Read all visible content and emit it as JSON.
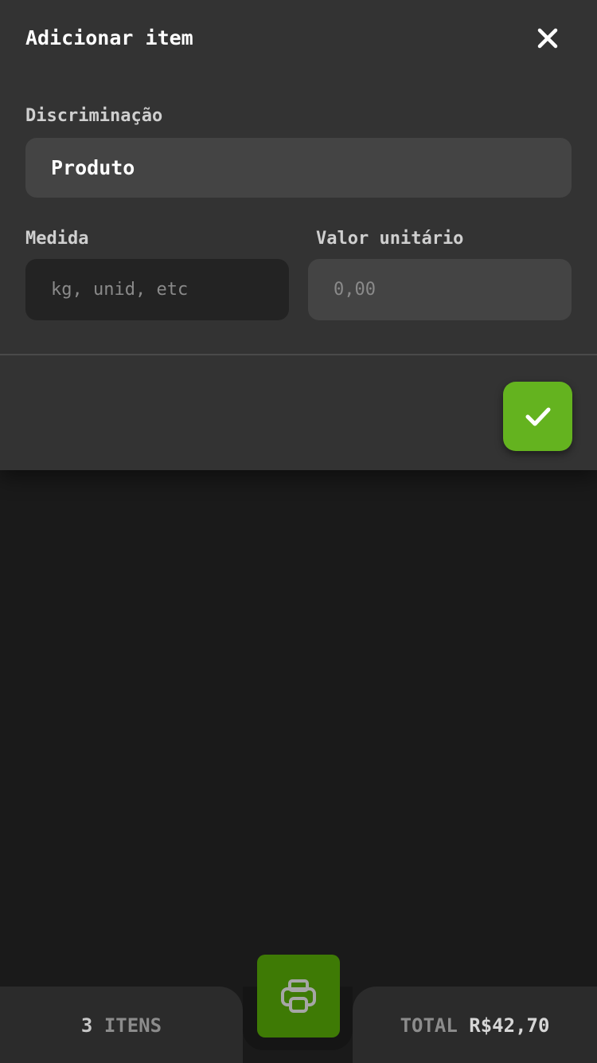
{
  "dialog": {
    "title": "Adicionar item",
    "description_label": "Discriminação",
    "description_value": "Produto",
    "measure_label": "Medida",
    "measure_placeholder": "kg, unid, etc",
    "unit_price_label": "Valor unitário",
    "unit_price_placeholder": "0,00"
  },
  "icons": {
    "close": "close-icon",
    "confirm": "check-icon",
    "print": "printer-icon"
  },
  "footer": {
    "item_count": "3",
    "items_label": "ITENS",
    "total_label": "TOTAL",
    "total_value": "R$42,70"
  },
  "colors": {
    "accent": "#64b31f",
    "print_button": "#3e7a05",
    "sheet_background": "#333333",
    "page_background": "#1a1a1a"
  }
}
